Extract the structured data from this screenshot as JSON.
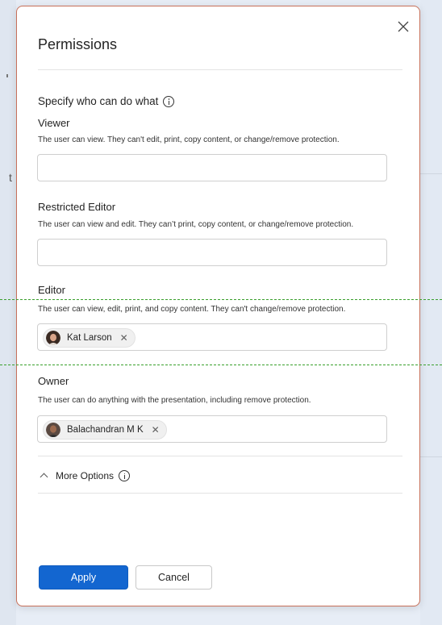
{
  "dialog": {
    "title": "Permissions",
    "close_icon": "close-icon",
    "subheading": "Specify who can do what",
    "info_icon": "info-icon"
  },
  "roles": [
    {
      "label": "Viewer",
      "description": "The user can view. They can't edit, print, copy content, or change/remove protection.",
      "users": []
    },
    {
      "label": "Restricted Editor",
      "description": "The user can view and edit. They can’t print, copy content, or change/remove protection.",
      "users": []
    },
    {
      "label": "Editor",
      "description": "The user can view, edit, print, and copy content. They can't change/remove protection.",
      "users": [
        {
          "name": "Kat Larson",
          "remove_icon": "close-icon"
        }
      ]
    },
    {
      "label": "Owner",
      "description": "The user can do anything with the presentation, including remove protection.",
      "users": [
        {
          "name": "Balachandran M K",
          "remove_icon": "close-icon"
        }
      ]
    }
  ],
  "more_options": {
    "label": "More Options",
    "state": "expanded"
  },
  "buttons": {
    "apply": "Apply",
    "cancel": "Cancel"
  },
  "background": {
    "fragment_text": "t"
  },
  "colors": {
    "accent": "#1366d0",
    "dialog_border": "#c7705a",
    "guide_line": "#3aa02c"
  }
}
